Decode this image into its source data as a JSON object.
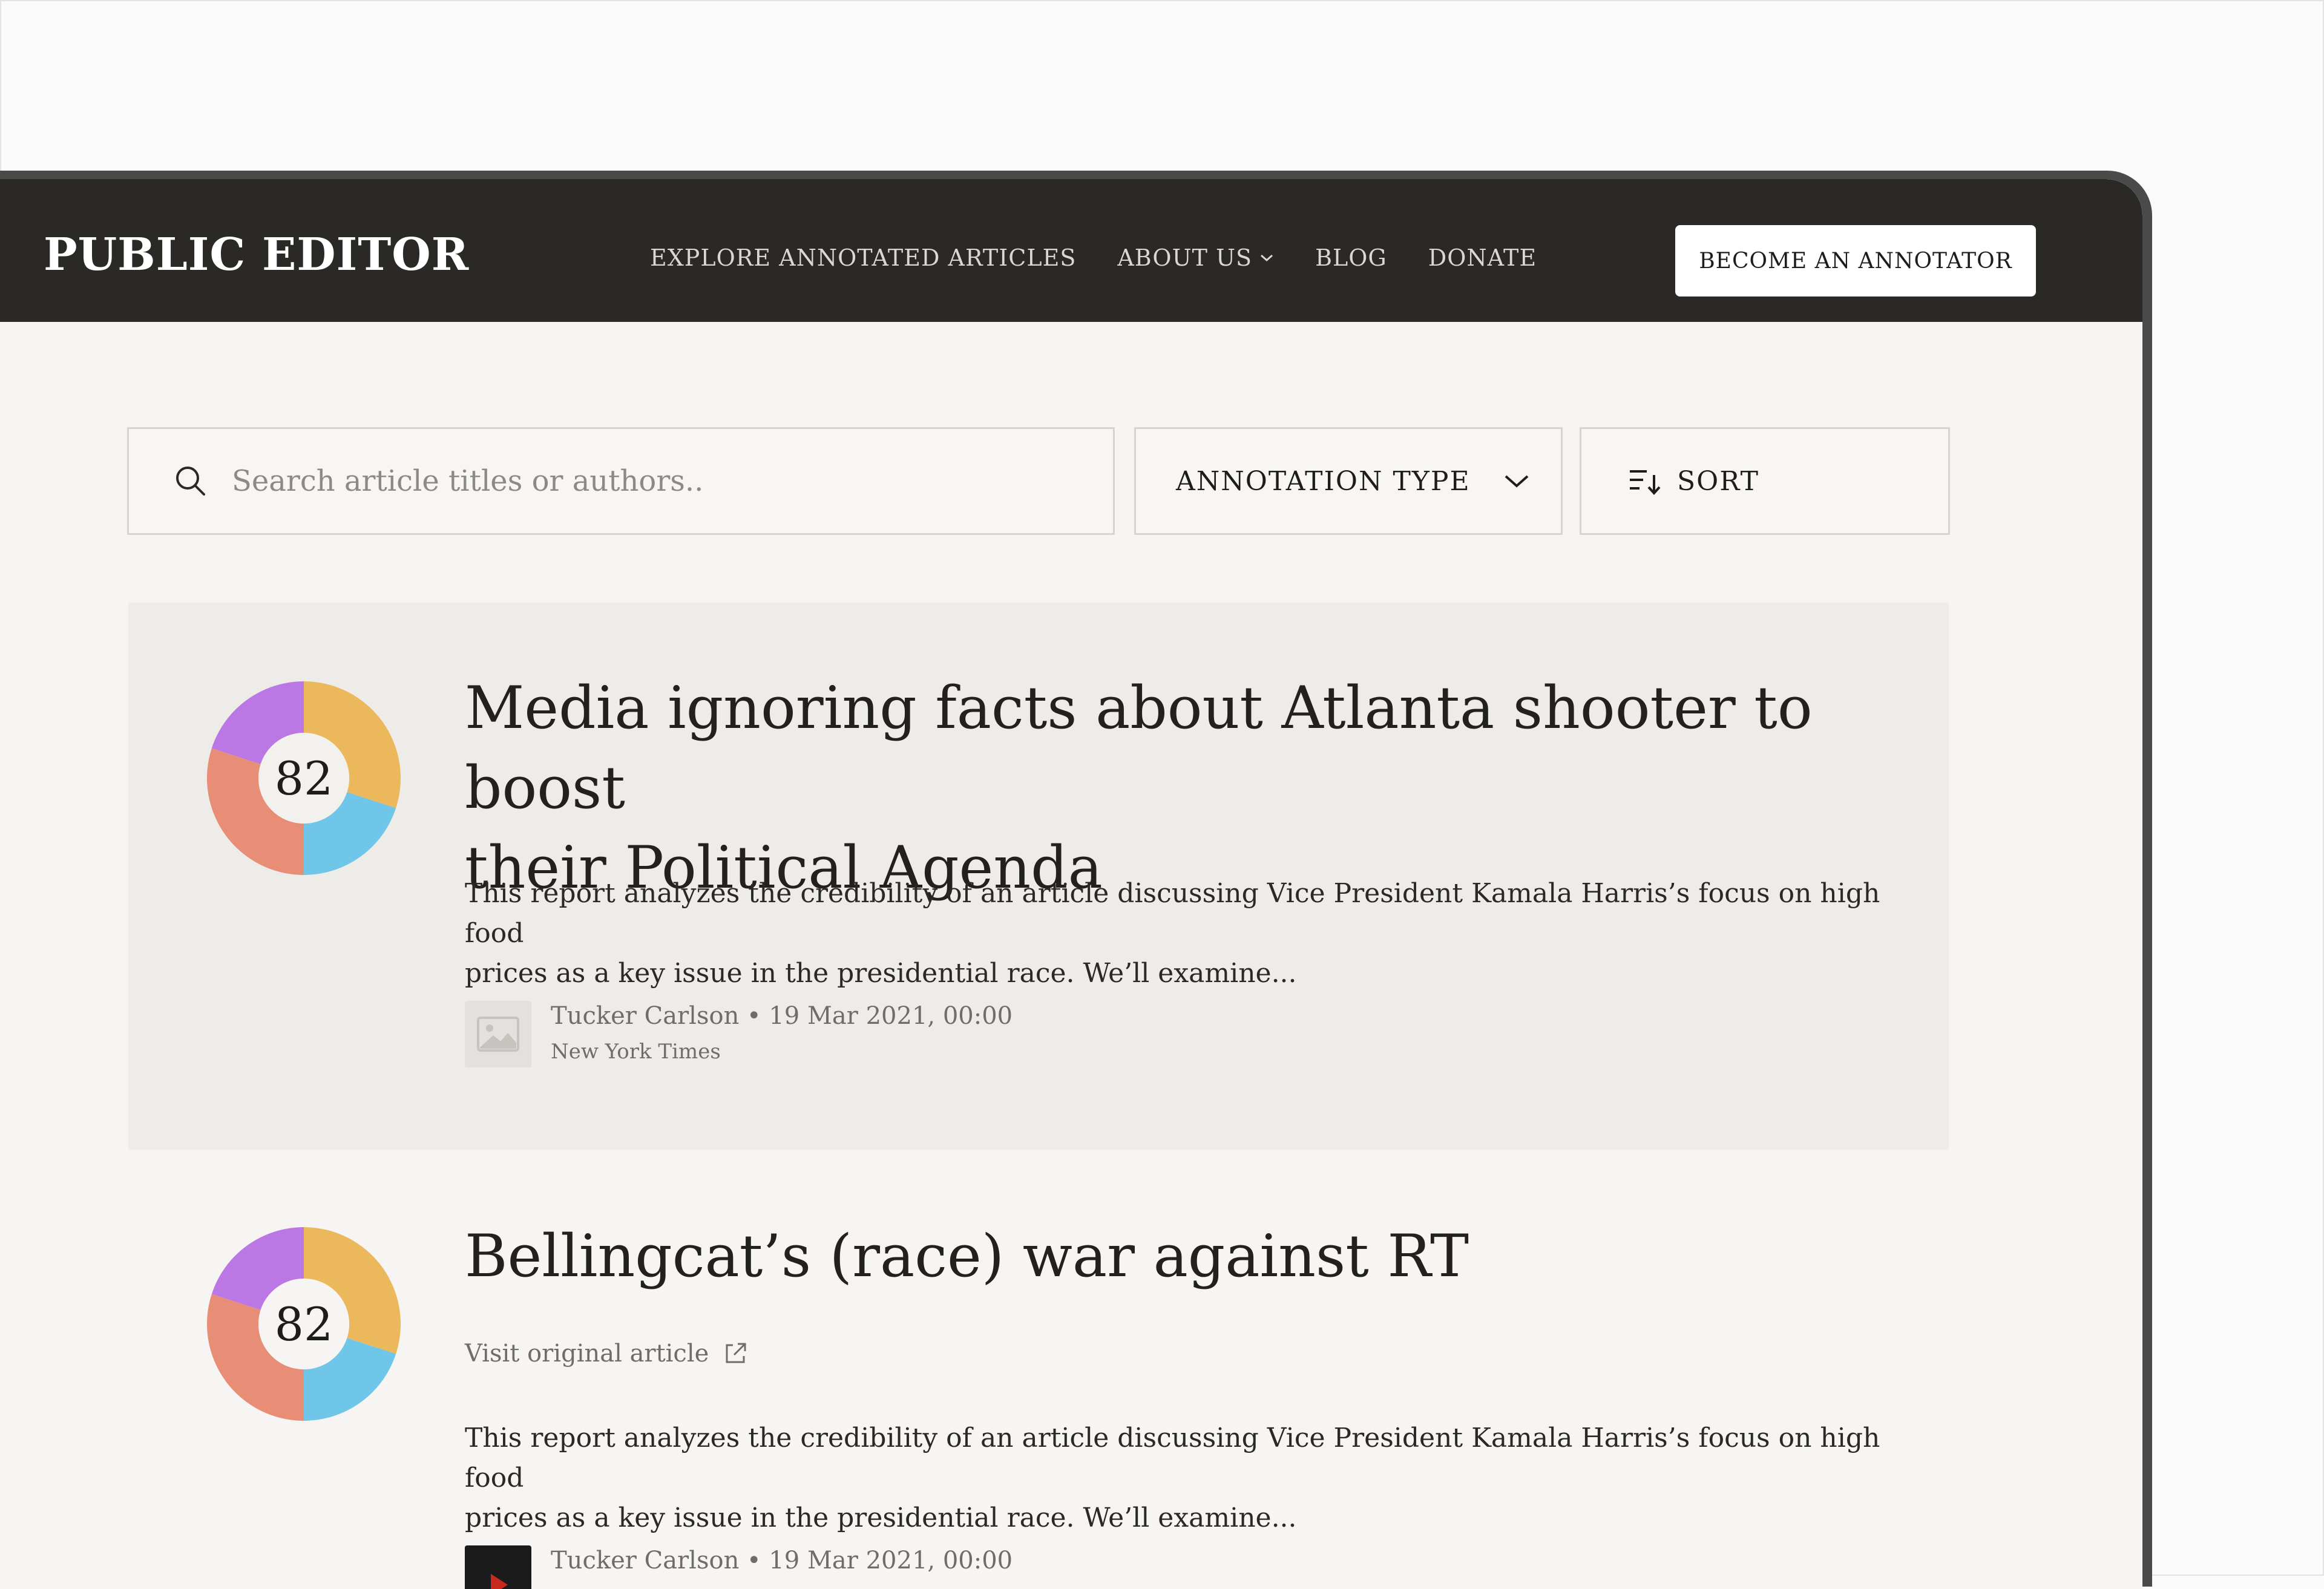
{
  "header": {
    "brand": "PUBLIC EDITOR",
    "nav": [
      "EXPLORE ANNOTATED ARTICLES",
      "ABOUT US",
      "BLOG",
      "DONATE"
    ],
    "cta": "BECOME AN ANNOTATOR"
  },
  "search": {
    "placeholder": "Search article titles or authors.."
  },
  "filter": {
    "label": "ANNOTATION TYPE"
  },
  "sort": {
    "label": "SORT"
  },
  "articles": [
    {
      "score": "82",
      "title_line1": "Media ignoring facts about Atlanta shooter to boost",
      "title_line2": "their Political Agenda",
      "desc_line1": "This report analyzes the credibility of an article discussing Vice President Kamala Harris’s focus on high food",
      "desc_line2": "prices as a key issue in the presidential race. We’ll examine...",
      "byline": "Tucker Carlson • 19 Mar 2021, 00:00",
      "source": "New York Times"
    },
    {
      "score": "82",
      "title_line1": "Bellingcat’s (race) war against RT",
      "visit": "Visit original article",
      "desc_line1": "This report analyzes the credibility of an article discussing Vice President Kamala Harris’s focus on high food",
      "desc_line2": "prices as a key issue in the presidential race. We’ll examine...",
      "byline": "Tucker Carlson • 19 Mar 2021, 00:00"
    }
  ],
  "colors": {
    "navbar": "#2a2926",
    "donut_yellow": "#ebb95c",
    "donut_blue": "#6fc6e8",
    "donut_coral": "#e98e76",
    "donut_purple": "#bb78e4"
  }
}
